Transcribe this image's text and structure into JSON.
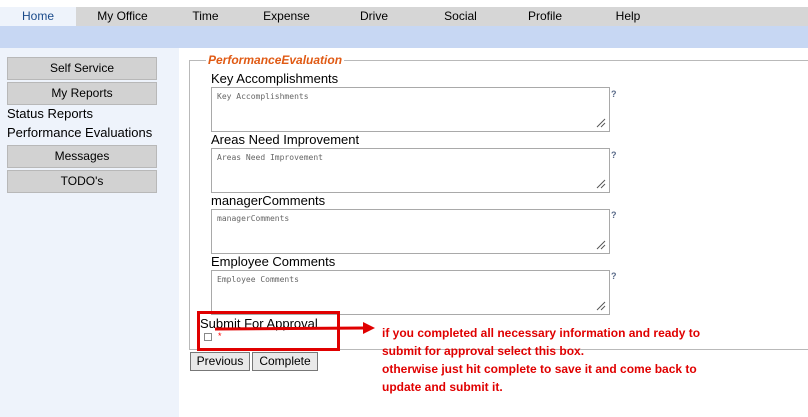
{
  "nav": {
    "items": [
      {
        "label": "Home"
      },
      {
        "label": "My Office"
      },
      {
        "label": "Time"
      },
      {
        "label": "Expense"
      },
      {
        "label": "Drive"
      },
      {
        "label": "Social"
      },
      {
        "label": "Profile"
      },
      {
        "label": "Help"
      }
    ],
    "active": "Home"
  },
  "sidebar": {
    "self_service": "Self Service",
    "my_reports": "My Reports",
    "status_reports": "Status Reports",
    "performance_evaluations": "Performance Evaluations",
    "messages": "Messages",
    "todos": "TODO's"
  },
  "form": {
    "legend": "PerformanceEvaluation",
    "fields": [
      {
        "label": "Key Accomplishments",
        "placeholder": "Key Accomplishments",
        "help": "?"
      },
      {
        "label": "Areas Need Improvement",
        "placeholder": "Areas Need Improvement",
        "help": "?"
      },
      {
        "label": "managerComments",
        "placeholder": "managerComments",
        "help": "?"
      },
      {
        "label": "Employee Comments",
        "placeholder": "Employee Comments",
        "help": "?"
      }
    ],
    "submit_label": "Submit For Approval",
    "submit_mark": "*",
    "previous_label": "Previous",
    "complete_label": "Complete"
  },
  "annotation": {
    "lines": [
      "if you completed all necessary information and ready to",
      "submit for approval select this box.",
      "otherwise just hit complete to save it and come back to",
      "update and submit it."
    ],
    "color": "#e00000"
  },
  "colors": {
    "nav_bg": "#d6d6d6",
    "subbar_bg": "#c7d7f3",
    "sidebar_bg": "#eef3fb",
    "legend": "#e05a14"
  }
}
